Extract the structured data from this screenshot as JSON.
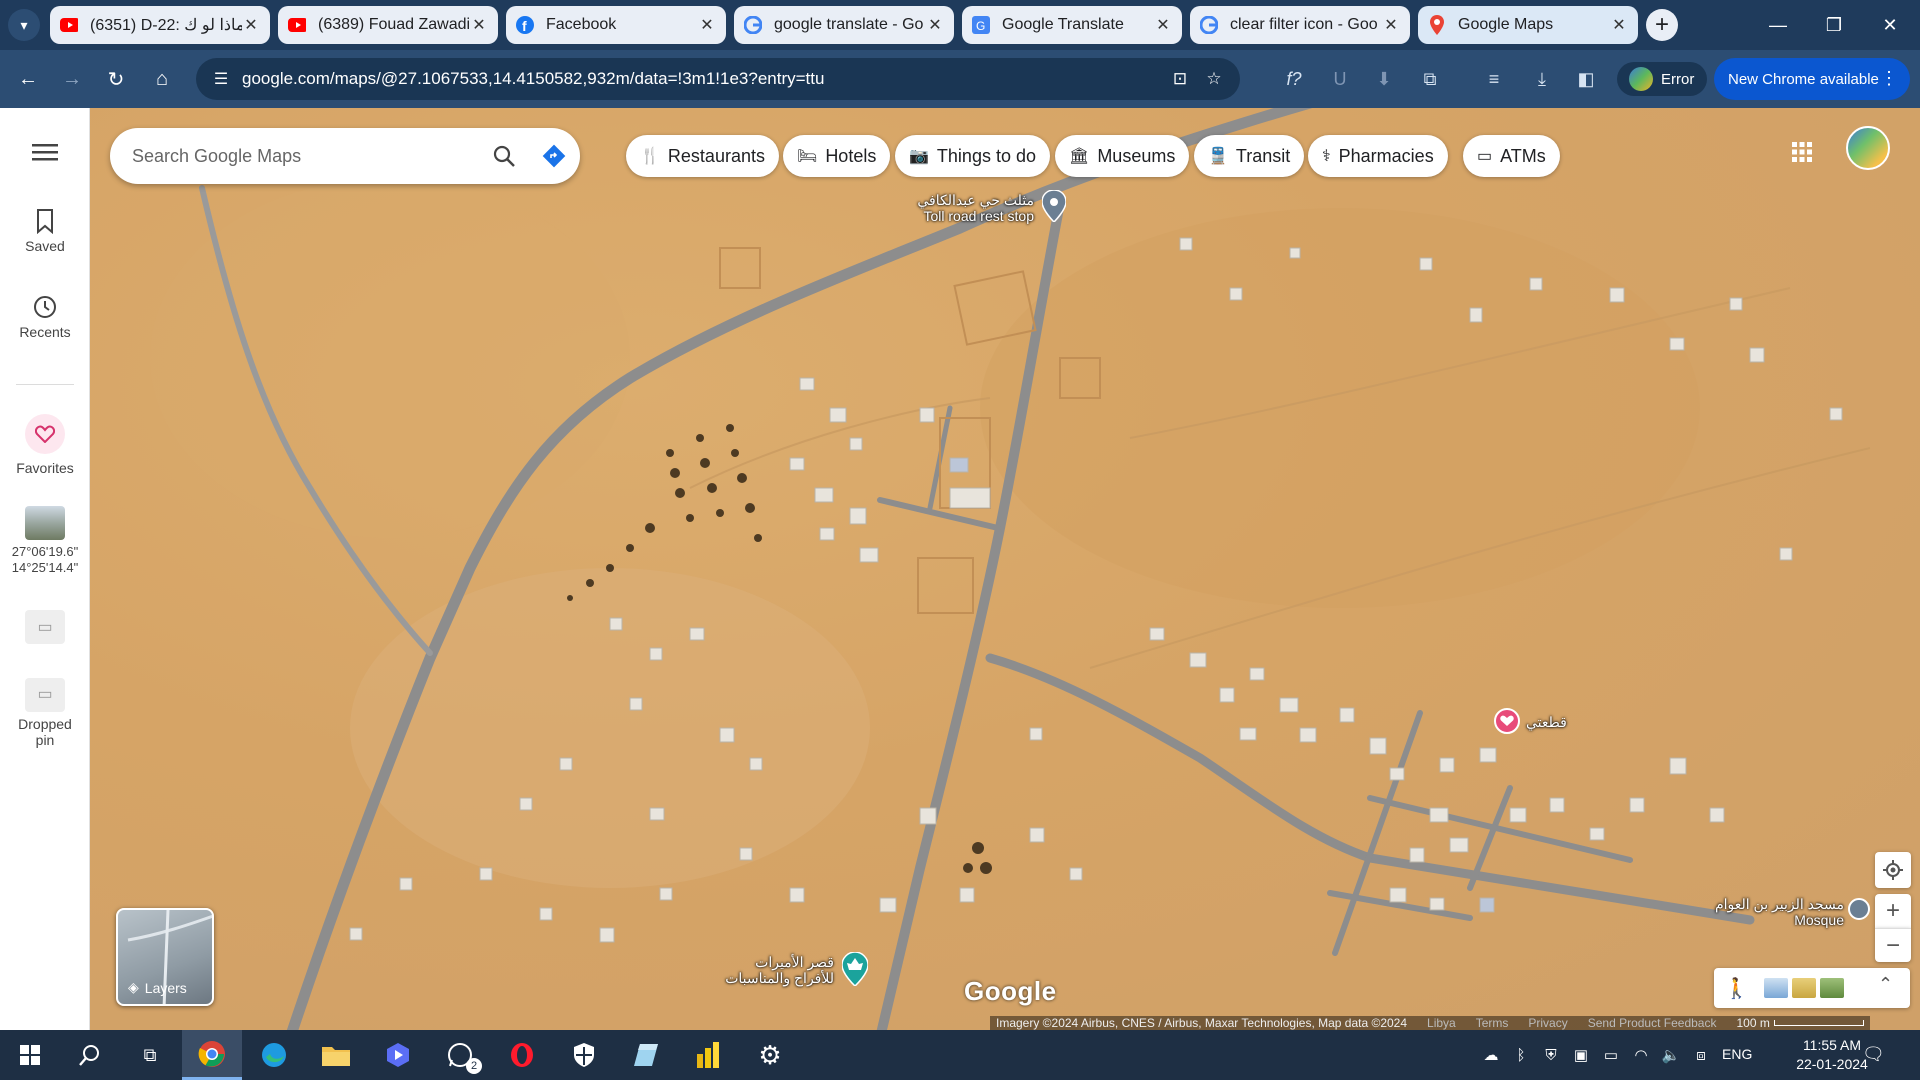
{
  "browser": {
    "tabs": [
      {
        "title": "(6351) D-22: ماذا لو ك",
        "icon": "youtube-icon"
      },
      {
        "title": "(6389) Fouad Zawadi",
        "icon": "youtube-icon"
      },
      {
        "title": "Facebook",
        "icon": "facebook-icon"
      },
      {
        "title": "google translate - Go",
        "icon": "google-icon"
      },
      {
        "title": "Google Translate",
        "icon": "google-translate-icon"
      },
      {
        "title": "clear filter icon - Goo",
        "icon": "google-icon"
      },
      {
        "title": "Google Maps",
        "icon": "google-maps-icon",
        "active": true
      }
    ],
    "url": "google.com/maps/@27.1067533,14.4150582,932m/data=!3m1!1e3?entry=ttu",
    "profile_label": "Error",
    "update_label": "New Chrome available"
  },
  "sidebar": {
    "saved": "Saved",
    "recents": "Recents",
    "favorites": "Favorites",
    "recent_coords_line1": "27°06'19.6\"",
    "recent_coords_line2": "14°25'14.4\"",
    "dropped_pin_line1": "Dropped",
    "dropped_pin_line2": "pin"
  },
  "search": {
    "placeholder": "Search Google Maps"
  },
  "chips": [
    "Restaurants",
    "Hotels",
    "Things to do",
    "Museums",
    "Transit",
    "Pharmacies",
    "ATMs"
  ],
  "map_labels": {
    "rest_stop_ar": "مثلث حي عبدالكافي",
    "rest_stop_en": "Toll road rest stop",
    "saved_place_ar": "قطعتي",
    "mosque_ar": "مسجد الزبير بن العوام",
    "mosque_en": "Mosque",
    "palace_line1": "قصر الأميرات",
    "palace_line2": "للأفراح والمناسبات",
    "layers": "Layers",
    "google_logo": "Google"
  },
  "attribution": {
    "imagery": "Imagery ©2024 Airbus, CNES / Airbus, Maxar Technologies, Map data ©2024",
    "country": "Libya",
    "terms": "Terms",
    "privacy": "Privacy",
    "feedback": "Send Product Feedback",
    "scale": "100 m"
  },
  "taskbar": {
    "whatsapp_badge": "2",
    "language": "ENG",
    "time": "11:55 AM",
    "date": "22-01-2024"
  },
  "colors": {
    "tabstrip": "#1f3b5c",
    "toolbar": "#2c4d73",
    "update_chip": "#0b57d0",
    "desert": "#d6a466",
    "road": "#8f8f8f",
    "taskbar": "#1e2f44"
  }
}
